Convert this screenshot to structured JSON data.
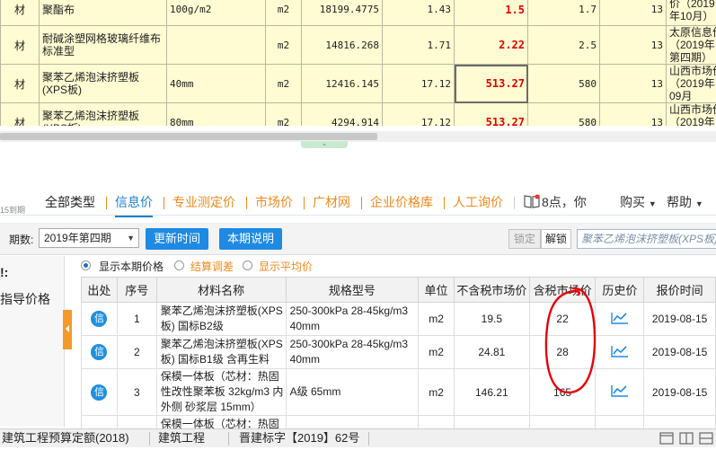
{
  "top_grid": {
    "rows": [
      {
        "type": "材",
        "name": "聚酯布",
        "spec": "100g/m2",
        "unit": "m2",
        "qty": "18199.4775",
        "p1": "1.43",
        "p2": "1.5",
        "p3": "1.7",
        "n": "13",
        "src": "价（2019年10月）"
      },
      {
        "type": "材",
        "name": "耐碱涂塑网格玻璃纤维布标准型",
        "spec": "",
        "unit": "m2",
        "qty": "14816.268",
        "p1": "1.71",
        "p2": "2.22",
        "p3": "2.5",
        "n": "13",
        "src": "太原信息价（2019年第四期）"
      },
      {
        "type": "材",
        "name": "聚苯乙烯泡沫挤塑板(XPS板)",
        "spec": "40mm",
        "unit": "m2",
        "qty": "12416.145",
        "p1": "17.12",
        "p2": "513.27",
        "p3": "580",
        "n": "13",
        "src": "山西市场价（2019年09月"
      },
      {
        "type": "材",
        "name": "聚苯乙烯泡沫挤塑板(XPS板)",
        "spec": "80mm",
        "unit": "m2",
        "qty": "4294.914",
        "p1": "17.12",
        "p2": "513.27",
        "p3": "580",
        "n": "13",
        "src": "山西市场价（2019年09月"
      }
    ]
  },
  "tabs": [
    {
      "label": "全部类型"
    },
    {
      "label": "信息价"
    },
    {
      "label": "专业测定价"
    },
    {
      "label": "市场价"
    },
    {
      "label": "广材网"
    },
    {
      "label": "企业价格库"
    },
    {
      "label": "人工询价"
    }
  ],
  "tab_extra": {
    "notice": "8点，你",
    "buy": "购买",
    "help": "帮助"
  },
  "left_count": "15到期",
  "toolbar": {
    "period_label": "期数:",
    "period_value": "2019年第四期",
    "refresh_label": "更新时间",
    "explain_label": "本期说明",
    "lock_label": "锁定",
    "unlock_label": "解锁",
    "search_value": "聚苯乙烯泡沫挤塑板(XPS板)"
  },
  "left_panel": {
    "title": "!:",
    "item": "指导价格"
  },
  "radios": [
    {
      "label": "显示本期价格",
      "checked": true
    },
    {
      "label": "结算调差",
      "checked": false
    },
    {
      "label": "显示平均价",
      "checked": false
    }
  ],
  "main_table": {
    "headers": [
      "出处",
      "序号",
      "材料名称",
      "规格型号",
      "单位",
      "不含税市场价",
      "含税市场价",
      "历史价",
      "报价时间"
    ],
    "badge_label": "信",
    "rows": [
      {
        "no": "1",
        "name": "聚苯乙烯泡沫挤塑板(XPS板) 国标B2级",
        "spec": "250-300kPa 28-45kg/m3 40mm",
        "unit": "m2",
        "price_ex": "19.5",
        "price_in": "22",
        "date": "2019-08-15"
      },
      {
        "no": "2",
        "name": "聚苯乙烯泡沫挤塑板(XPS板) 国标B1级 含再生料",
        "spec": "250-300kPa 28-45kg/m3 40mm",
        "unit": "m2",
        "price_ex": "24.81",
        "price_in": "28",
        "date": "2019-08-15"
      },
      {
        "no": "3",
        "name": "保模一体板（芯材：热固性改性聚苯板 32kg/m3 内外侧 砂浆层 15mm）",
        "spec": "A级 65mm",
        "unit": "m2",
        "price_ex": "146.21",
        "price_in": "165",
        "date": "2019-08-15"
      },
      {
        "no": "",
        "name": "保模一体板（芯材：热固",
        "spec": "",
        "unit": "",
        "price_ex": "",
        "price_in": "",
        "date": ""
      }
    ]
  },
  "statusbar": {
    "item1": "建筑工程预算定额(2018)",
    "item2": "建筑工程",
    "item3": "晋建标字【2019】62号"
  },
  "colors": {
    "accent": "#1e8ae4",
    "orange": "#f08a1c",
    "highlight_red": "#e00000",
    "annotation": "#e8000b"
  }
}
